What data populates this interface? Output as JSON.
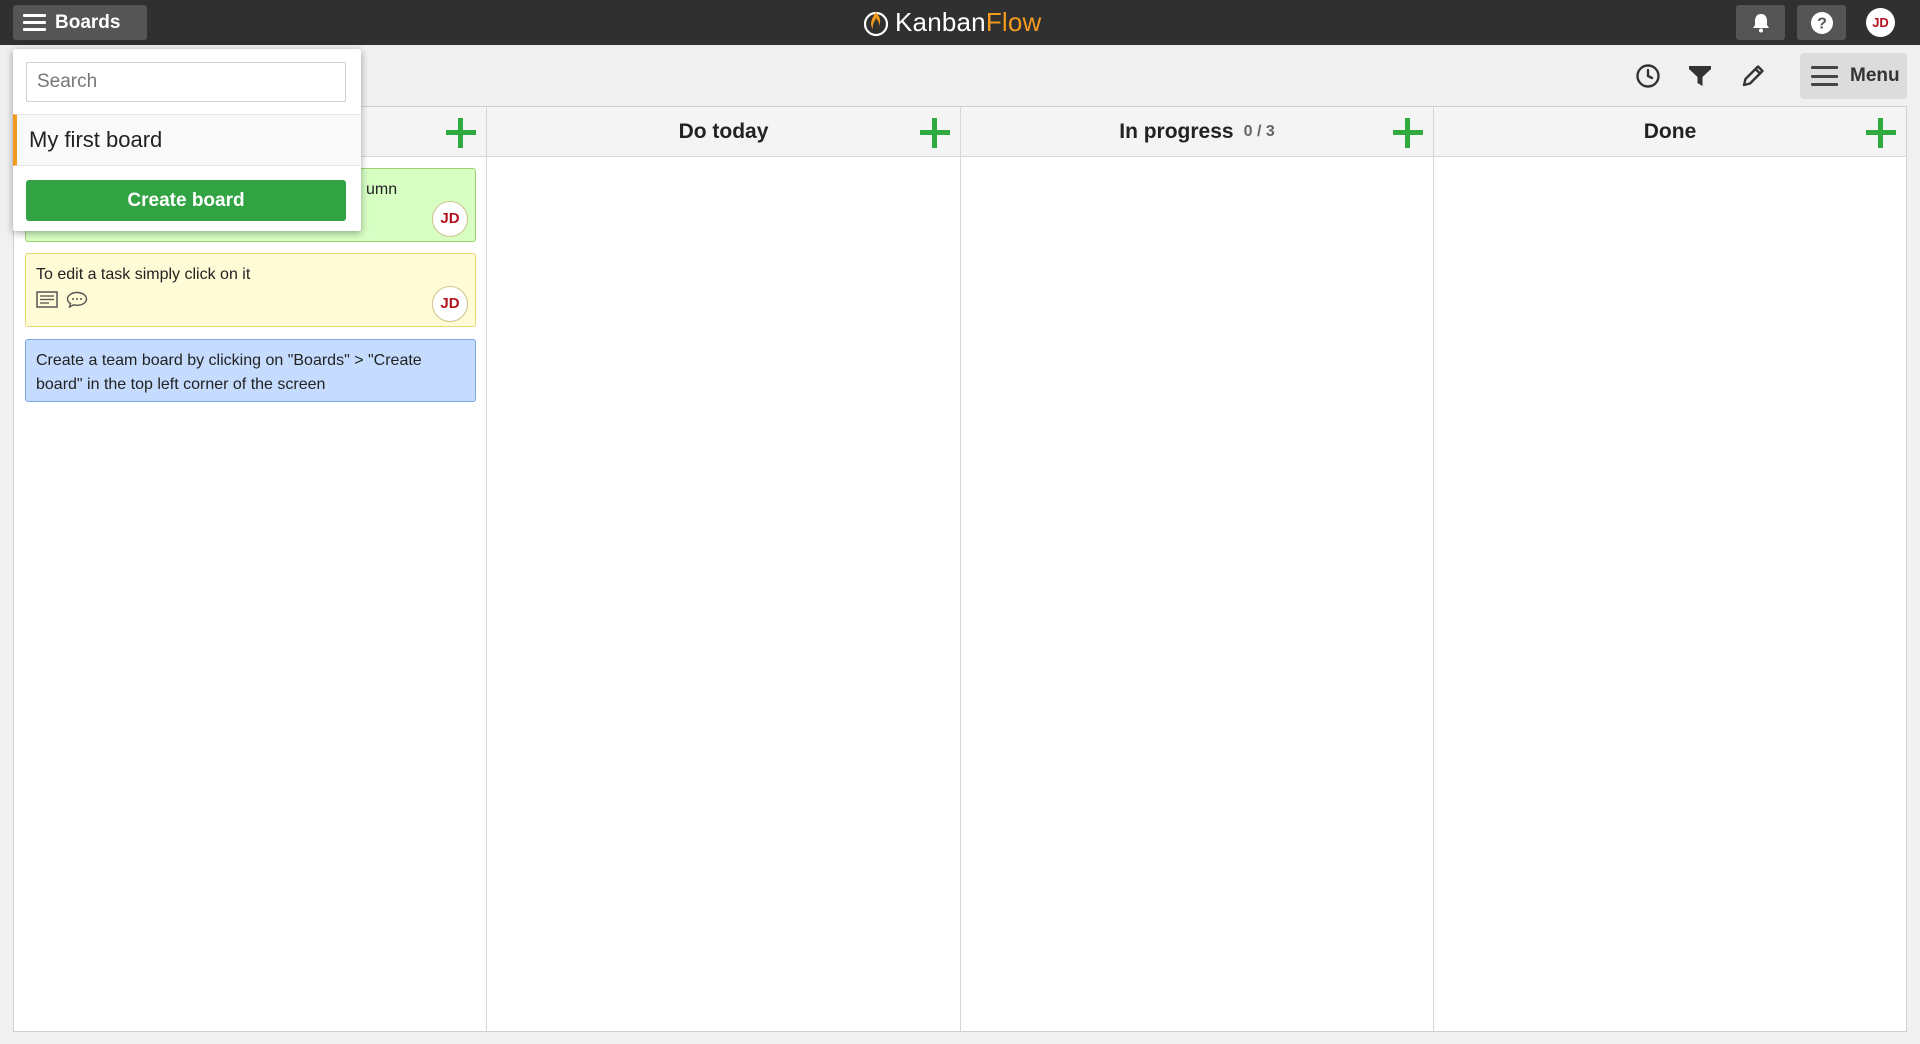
{
  "topbar": {
    "boards_label": "Boards",
    "logo_part1": "Kanban",
    "logo_part2": "Flow",
    "avatar_initials": "JD",
    "icons": [
      "bell-icon",
      "help-icon"
    ]
  },
  "toolbar": {
    "icons": [
      "clock-icon",
      "filter-icon",
      "pencil-icon"
    ],
    "menu_label": "Menu"
  },
  "columns": [
    {
      "title": "",
      "wip": ""
    },
    {
      "title": "Do today",
      "wip": ""
    },
    {
      "title": "In progress",
      "wip": "0 / 3"
    },
    {
      "title": "Done",
      "wip": ""
    }
  ],
  "tasks": [
    {
      "text": "umn",
      "color": "green",
      "avatar": "JD"
    },
    {
      "text": "To edit a task simply click on it",
      "color": "yellow",
      "avatar": "JD",
      "icons": [
        "description-icon",
        "comment-icon"
      ]
    },
    {
      "text": "Create a team board by clicking on \"Boards\" > \"Create board\" in the top left corner of the screen",
      "color": "blue"
    }
  ],
  "dropdown": {
    "search_placeholder": "Search",
    "boards": [
      "My first board"
    ],
    "create_label": "Create board"
  },
  "colors": {
    "accent_orange": "#f39a1e",
    "green": "#2eaa3e",
    "task_green": "#d7ffc4",
    "task_yellow": "#fffbd6",
    "task_blue": "#c5dcff"
  }
}
